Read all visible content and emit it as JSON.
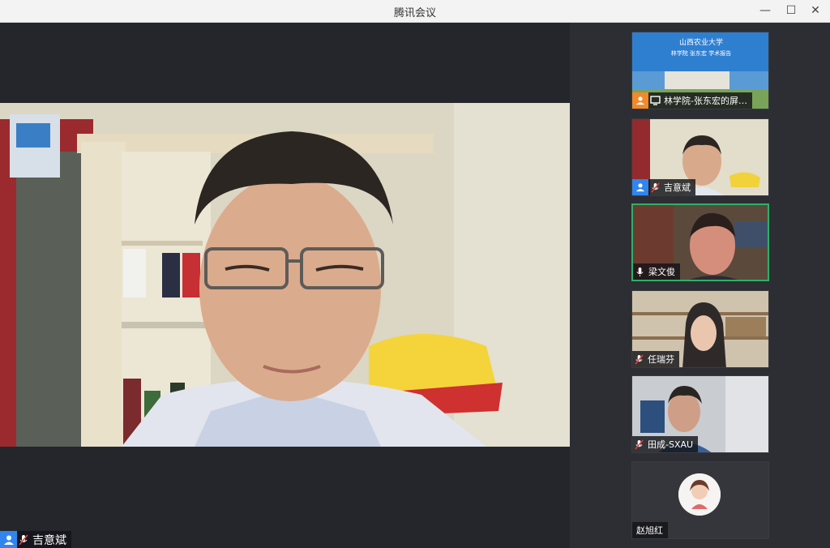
{
  "window": {
    "title": "腾讯会议",
    "minimize": "—",
    "maximize": "☐",
    "close": "✕"
  },
  "main_speaker": {
    "name": "吉意斌"
  },
  "participants": [
    {
      "name": "林学院-张东宏的屏…",
      "kind": "screen-share",
      "slide_title": "山西农业大学",
      "slide_subtitle": "林学院 张东宏 学术报告"
    },
    {
      "name": "吉意斌",
      "kind": "video"
    },
    {
      "name": "梁文俊",
      "kind": "video",
      "active": true
    },
    {
      "name": "任瑞芬",
      "kind": "video"
    },
    {
      "name": "田成-SXAU",
      "kind": "video"
    },
    {
      "name": "赵旭红",
      "kind": "avatar"
    }
  ],
  "colors": {
    "accent_blue": "#2f86ee",
    "active_border": "#2fb067",
    "share_orange": "#f2892a"
  }
}
